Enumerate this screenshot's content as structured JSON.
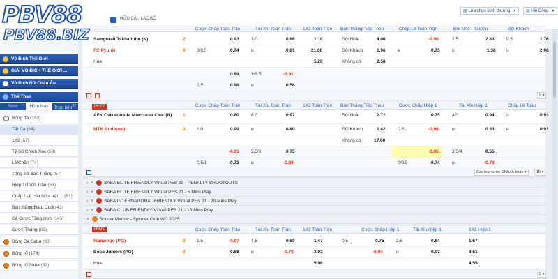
{
  "brand": {
    "logo_top": "PBV88",
    "logo_bottom": "PBV88.BIZ"
  },
  "header": {
    "section_label": "HỮU CÂU LẠC BỘ",
    "sort_select": "Lựa chọn bình thường",
    "odds_select": "Hai Dòng"
  },
  "sidebar": {
    "groups": [
      {
        "label": "Vô Địch Thế Giới"
      },
      {
        "label": "GIẢI VÔ ĐỊCH THẾ GIỚI ..."
      },
      {
        "label": "Vô Địch Nữ Châu Âu"
      },
      {
        "label": "Thể Thao"
      }
    ],
    "tabs": [
      "Sớm",
      "Hôm Nay",
      "Trực tiếp"
    ],
    "live_count": "97",
    "items": [
      {
        "label": "Bóng đá",
        "count": "(150)"
      },
      {
        "label": "Tất Cả",
        "count": "(64)"
      },
      {
        "label": "1X2",
        "count": "(67)"
      },
      {
        "label": "Tỷ Số Chính Xác",
        "count": "(59)"
      },
      {
        "label": "Lẻ/Chẵn",
        "count": "(74)"
      },
      {
        "label": "Tổng Số Bàn Thắng",
        "count": "(57)"
      },
      {
        "label": "Hiệp 1/Toàn Trận",
        "count": "(53)"
      },
      {
        "label": "Chấp / Lẻ của Nửa trận...",
        "count": "(51)"
      },
      {
        "label": "Bàn thắng Đầu/ Cuối",
        "count": "(43)"
      },
      {
        "label": "Cá Cược Tổng Hợp",
        "count": "(145)"
      },
      {
        "label": "Cược Thắng",
        "count": "(66)"
      },
      {
        "label": "Bóng Đá Saba",
        "count": "(30)"
      },
      {
        "label": "Bóng rổ",
        "count": "(174)"
      },
      {
        "label": "Bóng rổ Saba",
        "count": "(32)"
      }
    ]
  },
  "columns_a": {
    "ft_hdp": "Cược Chấp Toàn Trận",
    "ft_ou": "Tài Xỉu Toàn Trận",
    "ft_1x2": "1X2 Toàn Trận",
    "next_goal": "Bàn Thắng Tiếp Theo",
    "oe_hdp": "Chấp Lẻ Toàn Trận",
    "team_ou": "Đội Nhà - Tài/Xỉu",
    "away_ou": "Đội Khách - Tài/Xỉu"
  },
  "columns_b": {
    "ft_hdp": "Cược Chấp Toàn Trận",
    "ft_ou": "Tài Xỉu Toàn Trận",
    "ft_1x2": "1X2 Toàn Trận",
    "next_goal": "Bàn Thắng Tiếp Theo",
    "h1_hdp": "Cược Chấp Hiệp 1",
    "h1_ou": "Tài Xỉu Hiệp 1",
    "h1_oe": "Chấp Lẻ Toàn Trận"
  },
  "match1": {
    "home": "Samgurali Tskhaltubo (N)",
    "away": "FC Pyunik",
    "draw": "Hòa",
    "home_score": "2",
    "away_score": "0",
    "r1": {
      "hdp_odd": "0.93",
      "ou_line": "3.0",
      "ou_odd": "0.86",
      "x12": "1.10",
      "ng_lbl": "Đội Nhà",
      "ng": "4.00",
      "oe_odd": "-0.90",
      "h_line": "2.5",
      "h_odd": "2.83",
      "a_line": "0.5",
      "a_odd": "1.76"
    },
    "r2": {
      "hdp_line": "0/0.5",
      "hdp_odd": "0.74",
      "ou_lbl": "u",
      "ou_odd": "0.81",
      "x12": "21.00",
      "ng_lbl": "Đội Khách",
      "ng": "1.96",
      "oe_lbl": "e",
      "oe_odd": "0.73",
      "h_lbl": "u",
      "h_odd": "1.38",
      "a_lbl": "u",
      "a_odd": "2.06"
    },
    "r3": {
      "x12": "5.20",
      "ng_lbl": "Không có",
      "ng": "2.58"
    },
    "r4": {
      "hdp_odd": "0.69",
      "ou_line": "3/3.5",
      "ou_odd": "-0.91"
    },
    "r5": {
      "hdp_line": "0.5",
      "hdp_odd": "0.98",
      "ou_lbl": "u",
      "ou_odd": "0.58"
    }
  },
  "pager1": "9",
  "match2": {
    "time": "1H 22'",
    "home": "AFK Csikszereda Miercurea Ciuc (N)",
    "away": "MTK Budapest",
    "home_score": "1",
    "away_score": "3",
    "r1": {
      "hdp_odd": "0.80",
      "ou_line": "6.0",
      "ou_odd": "0.97",
      "ng_lbl": "Đội Nhà",
      "ng": "2.72",
      "h1_odd": "0.75",
      "h1ou_line": "4.0",
      "h1ou_odd": "0.94",
      "oe_lbl": "o",
      "oe_odd": "0.93"
    },
    "r2": {
      "hdp_line": "1.0",
      "hdp_odd": "0.99",
      "ou_lbl": "u",
      "ou_odd": "0.80",
      "ng_lbl": "Đội Khách",
      "ng": "1.42",
      "h1_line": "0.5",
      "h1_odd": "-0.96",
      "h1ou_lbl": "u",
      "h1ou_odd": "0.83",
      "oe_lbl": "e",
      "oe_odd": "0.91"
    },
    "r3": {
      "ng_lbl": "Không có",
      "ng": "17.00"
    },
    "r4": {
      "hdp_odd": "-0.93",
      "ou_line": "5.5/6",
      "ou_odd": "0.75",
      "h1_odd": "-0.95",
      "h1ou_line": "3.5/4",
      "h1ou_odd": "0.55"
    },
    "r5": {
      "hdp_line": "0.5/1",
      "hdp_odd": "0.72",
      "ou_lbl": "u",
      "ou_odd": "-0.98",
      "h1_line": "0/0.5",
      "h1_odd": "0.74",
      "h1ou_lbl": "u",
      "h1ou_odd": "-0.78"
    }
  },
  "toolbar2": {
    "bet_types": "Các loại cược Châu Á khác",
    "page": "15"
  },
  "leagues": [
    "SABA ELITE FRIENDLY Virtual PES 23 - PENALTY SHOOTOUTS",
    "SABA ELITE FRIENDLY Virtual PES 21 - 5 Mins Play",
    "SABA INTERNATIONAL FRIENDLY Virtual PES 21 - 20 Mins Play",
    "SABA CLUB FRIENDLY Virtual PES 21 - 15 Mins Play"
  ],
  "marble_league": "Soccer Marble - Spinner Club WC 2025",
  "columns_c": {
    "ft_hdp": "Cược Chấp Toàn Trận",
    "ft_ou": "Tài Xỉu Toàn Trận",
    "ft_1x2": "1X2 Toàn Trận",
    "h1_hdp": "Cược Chấp Hiệp 1",
    "h1_ou": "Tài Xỉu Hiệp 1",
    "h1_1x2": "1X2 Hiệp 1"
  },
  "match3": {
    "time": "TRỰC",
    "home": "Flamengo (PG)",
    "away": "Boca Juniors (PG)",
    "draw": "Hòa",
    "home_score": "0",
    "away_score": "0",
    "r1": {
      "hdp_line": "1.5",
      "hdp_odd": "-0.87",
      "ou_line": "4.5",
      "ou_odd": "0.59",
      "x12": "1.47",
      "h1_line": "0.5",
      "h1_odd": "0.75",
      "h1ou_line": "2.5",
      "h1ou_odd": "0.84",
      "h1x": "1.67"
    },
    "r2": {
      "hdp_odd": "0.68",
      "ou_lbl": "u",
      "ou_odd": "-0.78",
      "x12": "3.93",
      "h1_odd": "-0.94",
      "h1ou_lbl": "u",
      "h1ou_odd": "0.97",
      "h1x": "3.51"
    },
    "r3": {
      "x12": "5.96",
      "h1x": "4.55"
    }
  },
  "pager3": "2"
}
